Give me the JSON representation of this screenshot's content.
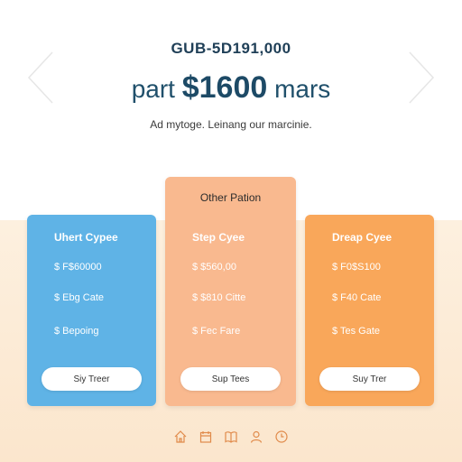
{
  "header": {
    "kicker": "GUB-5D191,000",
    "headline_pre": "part",
    "headline_price": "$1600",
    "headline_post": "mars",
    "tagline": "Ad mytoge. Leinang our marcinie."
  },
  "cards": [
    {
      "title": "Uhert Cypee",
      "lines": [
        "$ F$60000",
        "$ Ebg Cate",
        "$ Bepoing"
      ],
      "button": "Siy Treer",
      "color": "#5fb3e6"
    },
    {
      "featured_label": "Other Pation",
      "title": "Step Cyee",
      "lines": [
        "$ $560,00",
        "$ $810 Citte",
        "$ Fec Fare"
      ],
      "button": "Sup Tees",
      "color": "#f9b98f"
    },
    {
      "title": "Dreap Cyee",
      "lines": [
        "$ F0$S100",
        "$ F40 Cate",
        "$ Tes Gate"
      ],
      "button": "Suy Trer",
      "color": "#f9a75a"
    }
  ],
  "footer_icons": [
    "home-icon",
    "calendar-icon",
    "book-icon",
    "user-icon",
    "clock-icon"
  ],
  "colors": {
    "accent_title": "#1f3f57",
    "band": "#fdf0df",
    "icon": "#e08a4a"
  }
}
